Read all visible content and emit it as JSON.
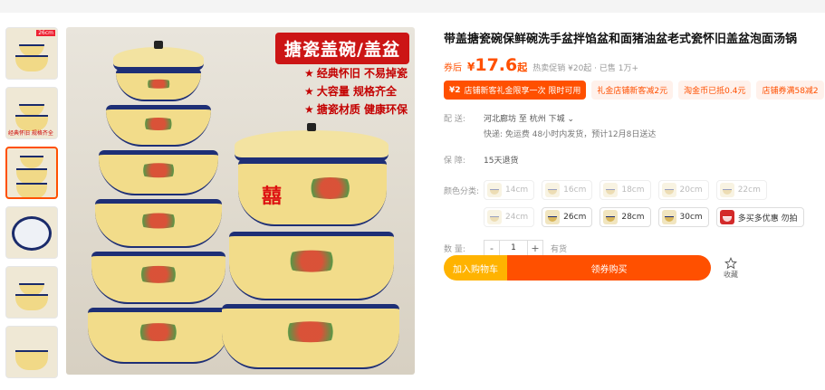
{
  "product": {
    "title": "带盖搪瓷碗保鲜碗洗手盆拌馅盆和面猪油盆老式瓷怀旧盖盆泡面汤锅",
    "price_label": "券后",
    "price_currency": "¥",
    "price_value": "17.6",
    "price_unit": "起",
    "price_note": "热卖促销 ¥20起 · 已售 1万+"
  },
  "promos": {
    "main_amount": "¥2",
    "main_text": "店铺新客礼金限享一次 限时可用",
    "tag1": "礼金店铺新客减2元",
    "tag2": "淘金币已抵0.4元",
    "tag3": "店铺券满58减2"
  },
  "shipping": {
    "label": "配 送:",
    "route": "河北廊坊  至  杭州 下城 ⌄",
    "detail": "快递: 免运费  48小时内发货，预计12月8日送达"
  },
  "guarantee": {
    "label": "保 障:",
    "value": "15天退货"
  },
  "variants": {
    "label": "颜色分类:",
    "options": [
      "14cm",
      "16cm",
      "18cm",
      "20cm",
      "22cm",
      "24cm",
      "26cm",
      "28cm",
      "30cm",
      "多买多优惠 勿拍"
    ]
  },
  "quantity": {
    "label": "数 量:",
    "minus": "-",
    "value": "1",
    "plus": "+",
    "stock": "有货"
  },
  "actions": {
    "cart_label": "加入购物车",
    "buy_label": "领券购买",
    "favorite_label": "收藏"
  },
  "image": {
    "banner": "搪瓷盖碗/盖盆",
    "features": [
      "经典怀旧  不易掉瓷",
      "大容量  规格齐全",
      "搪瓷材质  健康环保"
    ],
    "xi": "囍"
  },
  "thumbs": {
    "tag": "26cm",
    "caption": "经典怀旧 规格齐全"
  }
}
